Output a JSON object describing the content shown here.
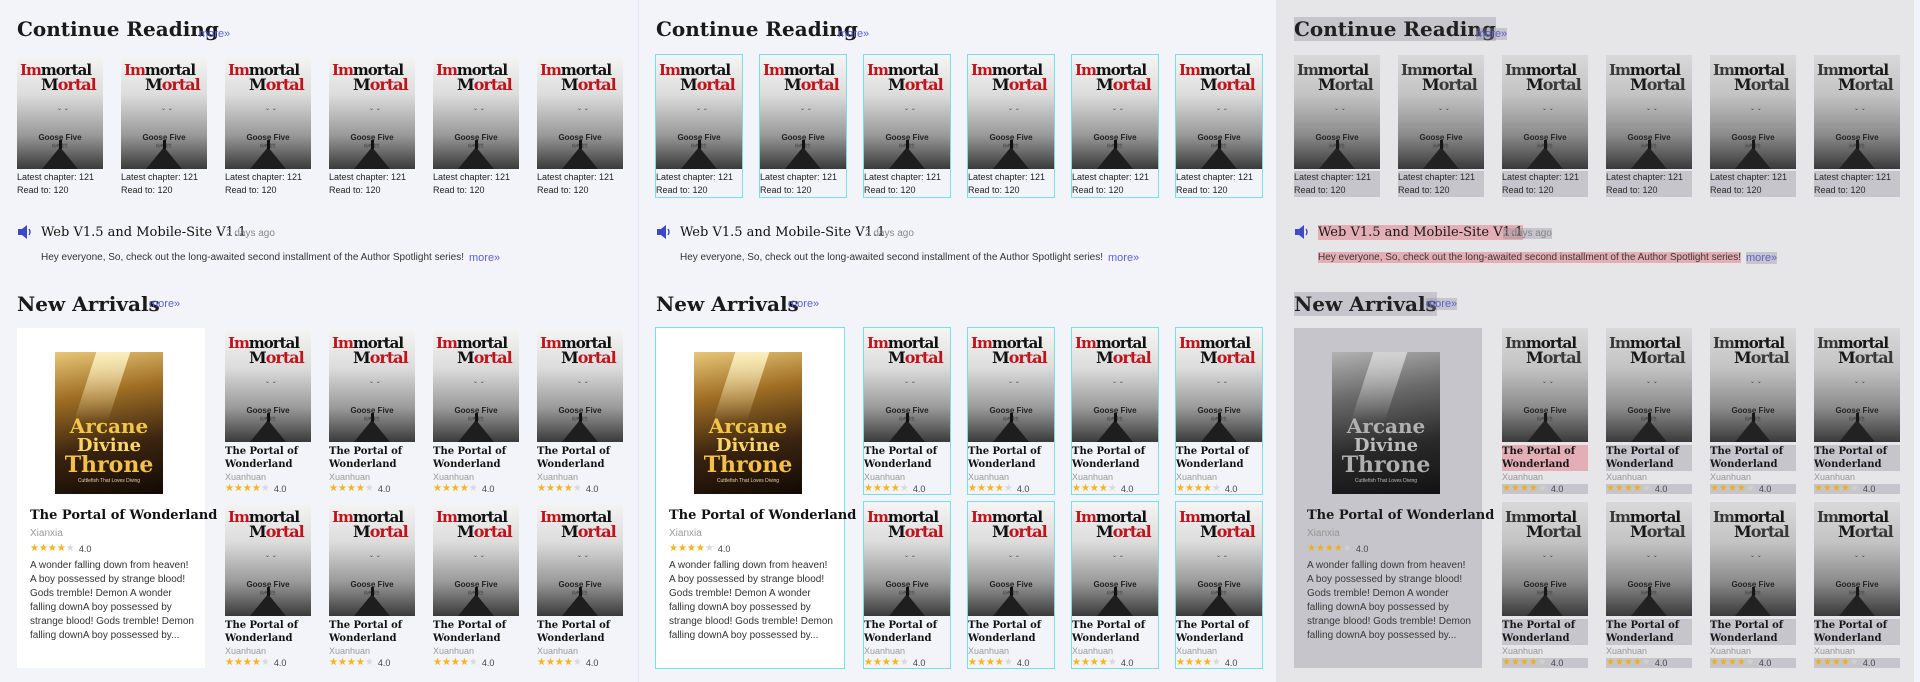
{
  "continue_reading": {
    "title": "Continue Reading",
    "more": "more»",
    "books": [
      {
        "latest": "Latest chapter: 121",
        "read": "Read to: 120"
      },
      {
        "latest": "Latest chapter: 121",
        "read": "Read to: 120"
      },
      {
        "latest": "Latest chapter: 121",
        "read": "Read to: 120"
      },
      {
        "latest": "Latest chapter: 121",
        "read": "Read to: 120"
      },
      {
        "latest": "Latest chapter: 121",
        "read": "Read to: 120"
      },
      {
        "latest": "Latest chapter: 121",
        "read": "Read to: 120"
      }
    ]
  },
  "cover": {
    "line1_a": "Im",
    "line1_b": "mortal",
    "line2_a": "M",
    "line2_b": "ortal",
    "author": "Goose Five",
    "subtitle": "仙帝重生"
  },
  "announcement": {
    "icon": "speaker-icon",
    "title": "Web V1.5 and Mobile-Site V1.1",
    "time": "2 days ago",
    "body": "Hey everyone, So, check out the long-awaited second installment of the Author Spotlight series!",
    "more": "more»"
  },
  "new_arrivals": {
    "title": "New Arrivals",
    "more": "more»",
    "featured": {
      "cover_l1": "Arcane",
      "cover_l2": "Divine",
      "cover_l3": "Throne",
      "cover_l4": "Cuttlefish That Loves Diving",
      "title": "The Portal of Wonderland",
      "genre": "Xianxia",
      "rating": 4.0,
      "rating_text": "4.0",
      "description": "A wonder falling down from heaven! A boy possessed by strange blood! Gods tremble! Demon A wonder falling downA boy possessed by strange blood! Gods tremble! Demon falling downA boy possessed by..."
    },
    "books": [
      {
        "title": "The Portal of Wonderland",
        "genre": "Xuanhuan",
        "rating": 4.0,
        "rating_text": "4.0"
      },
      {
        "title": "The Portal of Wonderland",
        "genre": "Xuanhuan",
        "rating": 4.0,
        "rating_text": "4.0"
      },
      {
        "title": "The Portal of Wonderland",
        "genre": "Xuanhuan",
        "rating": 4.0,
        "rating_text": "4.0"
      },
      {
        "title": "The Portal of Wonderland",
        "genre": "Xuanhuan",
        "rating": 4.0,
        "rating_text": "4.0"
      },
      {
        "title": "The Portal of Wonderland",
        "genre": "Xuanhuan",
        "rating": 4.0,
        "rating_text": "4.0"
      },
      {
        "title": "The Portal of Wonderland",
        "genre": "Xuanhuan",
        "rating": 4.0,
        "rating_text": "4.0"
      },
      {
        "title": "The Portal of Wonderland",
        "genre": "Xuanhuan",
        "rating": 4.0,
        "rating_text": "4.0"
      },
      {
        "title": "The Portal of Wonderland",
        "genre": "Xuanhuan",
        "rating": 4.0,
        "rating_text": "4.0"
      }
    ]
  },
  "colors": {
    "accent_link": "#5a5fd8",
    "star": "#f6b51e",
    "cover_red": "#c0141c",
    "debug_outline": "#77dfe6"
  }
}
